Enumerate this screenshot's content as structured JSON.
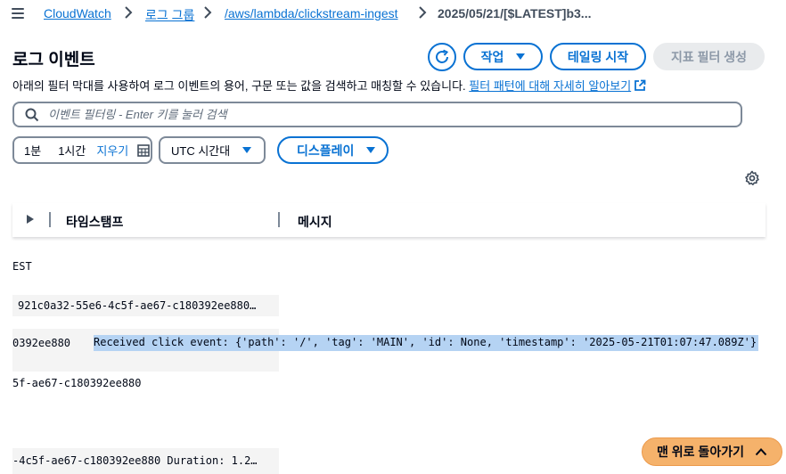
{
  "breadcrumb": {
    "items": [
      "CloudWatch",
      "로그 그룹",
      "/aws/lambda/clickstream-ingest",
      "2025/05/21/[$LATEST]b3..."
    ]
  },
  "header": {
    "title": "로그 이벤트",
    "actions_label": "작업",
    "tail_label": "테일링 시작",
    "create_filter_label": "지표 필터 생성"
  },
  "description": {
    "text": "아래의 필터 막대를 사용하여 로그 이벤트의 용어, 구문 또는 값을 검색하고 매칭할 수 있습니다.",
    "link": "필터 패턴에 대해 자세히 알아보기"
  },
  "search": {
    "placeholder": "이벤트 필터링 - Enter 키를 눌러 검색"
  },
  "controls": {
    "range_1m": "1분",
    "range_1h": "1시간",
    "clear": "지우기",
    "timezone": "UTC 시간대",
    "display": "디스플레이"
  },
  "table": {
    "col_timestamp": "타임스탬프",
    "col_message": "메시지"
  },
  "log_lines": {
    "l1": "EST",
    "l2": "921c0a32-55e6-4c5f-ae67-c180392ee880…",
    "l3_prefix": "0392ee880",
    "l3_message": "Received click event: {'path': '/', 'tag': 'MAIN', 'id': None, 'timestamp': '2025-05-21T01:07:47.089Z'}",
    "l4": "5f-ae67-c180392ee880",
    "l5": "-4c5f-ae67-c180392ee880 Duration: 1.2…"
  },
  "back_to_top": {
    "label": "맨 위로 돌아가기"
  },
  "colors": {
    "link": "#0972d3",
    "back_to_top": "#f5b26b",
    "highlight": "#b5d3f3"
  }
}
